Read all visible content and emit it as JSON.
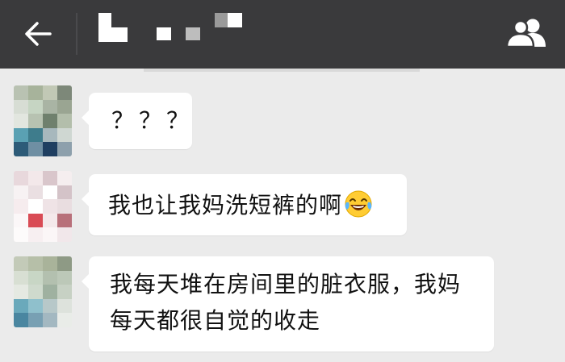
{
  "header": {
    "back_icon": "arrow-left-icon",
    "contacts_icon": "group-contacts-icon",
    "title_obscured": true
  },
  "messages": [
    {
      "text": "？？？",
      "emoji": null,
      "avatar_colors": [
        [
          "#b9c2b2",
          "#a7b39b",
          "#c1c8b5",
          "#7d8879"
        ],
        [
          "#d7ddd4",
          "#c6d5c3",
          "#a9b4a4",
          "#9aa592"
        ],
        [
          "#e2e6df",
          "#b7c2b1",
          "#6f806d",
          "#b3beab"
        ],
        [
          "#5aa1b3",
          "#3e7c8c",
          "#a7b8bd",
          "#cfd7d2"
        ],
        [
          "#2d5b78",
          "#6f8fa3",
          "#1f3f61",
          "#8da0ac"
        ]
      ]
    },
    {
      "text": "我也让我妈洗短裤的啊",
      "emoji": "face-with-tears-of-joy",
      "avatar_colors": [
        [
          "#e8d8dc",
          "#f3e8ea",
          "#d9c6cb",
          "#f5eeef"
        ],
        [
          "#f7f2f3",
          "#eadfe2",
          "#ffffff",
          "#d4c3c8"
        ],
        [
          "#f6ecee",
          "#ffffff",
          "#efe3e6",
          "#e9dde0"
        ],
        [
          "#fbf7f8",
          "#d94b55",
          "#f4e9eb",
          "#b8707a"
        ],
        [
          "#fdfbfb",
          "#f7eff1",
          "#fbf6f7",
          "#f1e7ea"
        ]
      ]
    },
    {
      "text": "我每天堆在房间里的脏衣服，我妈每天都很自觉的收走",
      "emoji": null,
      "avatar_colors": [
        [
          "#c3cab8",
          "#b6bfa8",
          "#a9b39a",
          "#8e9a85"
        ],
        [
          "#d8dfd3",
          "#c8d6c5",
          "#b3c0af",
          "#bcc8b8"
        ],
        [
          "#e5e9e2",
          "#cfdacd",
          "#9fb1a0",
          "#c7d1c4"
        ],
        [
          "#6aa9bb",
          "#8fc0cc",
          "#b7c8c9",
          "#dde2dc"
        ],
        [
          "#4a86a0",
          "#78a0b3",
          "#a3b8c1",
          "#e9ece8"
        ]
      ]
    }
  ]
}
